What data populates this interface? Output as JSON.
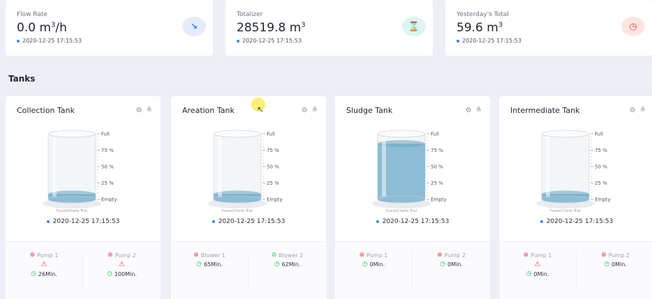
{
  "stats": [
    {
      "label": "Flow Rate",
      "value": "0.0 m",
      "sup": "3",
      "suffix": "/h",
      "timestamp": "2020-12-25 17:15:53",
      "icon": "trend-down-icon",
      "icon_glyph": "↘",
      "icon_bg": "#e4ecfb",
      "icon_color": "#3b82f6"
    },
    {
      "label": "Totalizer",
      "value": "28519.8 m",
      "sup": "3",
      "suffix": "",
      "timestamp": "2020-12-25 17:15:53",
      "icon": "hourglass-icon",
      "icon_glyph": "⌛",
      "icon_bg": "#dbf5f1",
      "icon_color": "#14b8a6"
    },
    {
      "label": "Yesterday's Total",
      "value": "59.6 m",
      "sup": "3",
      "suffix": "",
      "timestamp": "2020-12-25 17:15:53",
      "icon": "clock-icon",
      "icon_glyph": "◷",
      "icon_bg": "#fde6e2",
      "icon_color": "#ef4444"
    }
  ],
  "section_title": "Tanks",
  "tank_labels": {
    "full": "Full",
    "p75": "75 %",
    "p50": "50 %",
    "p25": "25 %",
    "empty": "Empty",
    "watermark": "FusionCharts Trial"
  },
  "tanks": [
    {
      "title": "Collection Tank",
      "level": 0.08,
      "timestamp": "2020-12-25 17:15:53",
      "equipment": [
        {
          "name": "Pump 1",
          "running": false,
          "warning": true,
          "time": "26Min."
        },
        {
          "name": "Pump 2",
          "running": false,
          "warning": true,
          "time": "100Min."
        }
      ]
    },
    {
      "title": "Areation Tank",
      "level": 0.08,
      "timestamp": "2020-12-25 17:15:53",
      "equipment": [
        {
          "name": "Blower 1",
          "running": false,
          "warning": false,
          "time": "65Min."
        },
        {
          "name": "Blower 2",
          "running": true,
          "warning": false,
          "time": "62Min."
        }
      ]
    },
    {
      "title": "Sludge Tank",
      "level": 0.85,
      "timestamp": "2020-12-25 17:15:53",
      "equipment": [
        {
          "name": "Pump 1",
          "running": false,
          "warning": false,
          "time": "0Min."
        },
        {
          "name": "Pump 2",
          "running": false,
          "warning": false,
          "time": "0Min."
        }
      ]
    },
    {
      "title": "Intermediate Tank",
      "level": 0.08,
      "timestamp": "2020-12-25 17:15:53",
      "equipment": [
        {
          "name": "Pump 1",
          "running": false,
          "warning": true,
          "time": "0Min."
        },
        {
          "name": "Pump 2",
          "running": false,
          "warning": false,
          "time": "0Min."
        }
      ]
    }
  ],
  "colors": {
    "liquid": "#8dbdd4",
    "liquid_dark": "#6fa8c3",
    "accent_blue": "#3b82f6",
    "on": "#22c55e",
    "off": "#ef4444"
  }
}
